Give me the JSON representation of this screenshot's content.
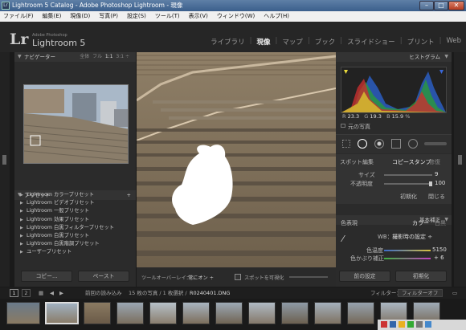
{
  "window": {
    "title": "Lightroom 5 Catalog - Adobe Photoshop Lightroom - 現像",
    "icon": "Lr",
    "min": "–",
    "max": "□",
    "close": "✕"
  },
  "menu": [
    "ファイル(F)",
    "編集(E)",
    "現像(D)",
    "写真(P)",
    "設定(S)",
    "ツール(T)",
    "表示(V)",
    "ウィンドウ(W)",
    "ヘルプ(H)"
  ],
  "logo": {
    "mark": "Lr",
    "sub": "Adobe Photoshop",
    "name": "Lightroom 5"
  },
  "modules": [
    {
      "label": "ライブラリ",
      "active": false
    },
    {
      "label": "現像",
      "active": true
    },
    {
      "label": "マップ",
      "active": false
    },
    {
      "label": "ブック",
      "active": false
    },
    {
      "label": "スライドショー",
      "active": false
    },
    {
      "label": "プリント",
      "active": false
    },
    {
      "label": "Web",
      "active": false
    }
  ],
  "navigator": {
    "title": "ナビゲーター",
    "zoom": [
      "全体",
      "フル",
      "1:1",
      "3:1"
    ]
  },
  "presets": {
    "title": "プリセット",
    "add": "+",
    "items": [
      "Lightroom カラープリセット",
      "Lightroom ビデオプリセット",
      "Lightroom 一般プリセット",
      "Lightroom 効果プリセット",
      "Lightroom 白黒フィルタープリセット",
      "Lightroom 白黒プリセット",
      "Lightroom 白黒階調プリセット",
      "ユーザープリセット"
    ]
  },
  "left_buttons": {
    "copy": "コピー...",
    "paste": "ペースト"
  },
  "histogram": {
    "title": "ヒストグラム",
    "r_label": "R",
    "r": "23.3",
    "g_label": "G",
    "g": "19.3",
    "b_label": "B",
    "b": "15.9",
    "pct": "%",
    "original": "元の写真"
  },
  "spot": {
    "label": "スポット編集",
    "clone": "コピースタンプ",
    "heal": "修復",
    "size_label": "サイズ",
    "size": "9",
    "opacity_label": "不透明度",
    "opacity": "100",
    "reset": "初期化",
    "close": "閉じる"
  },
  "basic": {
    "title": "基本補正",
    "treatment_label": "色表現",
    "color": "カラー",
    "bw": "白黒",
    "wb_label": "WB：",
    "wb_value": "撮影時の設定 ÷",
    "temp_label": "色温度",
    "temp": "5150",
    "tint_label": "色かぶり補正",
    "tint": "+ 6"
  },
  "right_buttons": {
    "previous": "前の設定",
    "reset": "初期化"
  },
  "toolbar": {
    "overlay_label": "ツールオーバーレイ：",
    "overlay_value": "常にオン ÷",
    "visualize": "スポットを可視化"
  },
  "filmstrip": {
    "page1": "1",
    "page2": "2",
    "source": "前回の読み込み",
    "count": "15 枚の写真 / 1 枚選択 /",
    "file": "R0240401.DNG",
    "filter_label": "フィルター：",
    "filter_value": "フィルターオフ"
  },
  "colors": {
    "accent": "#ffffff",
    "panel": "#2b2b2b",
    "title": "#3b5f8c"
  }
}
